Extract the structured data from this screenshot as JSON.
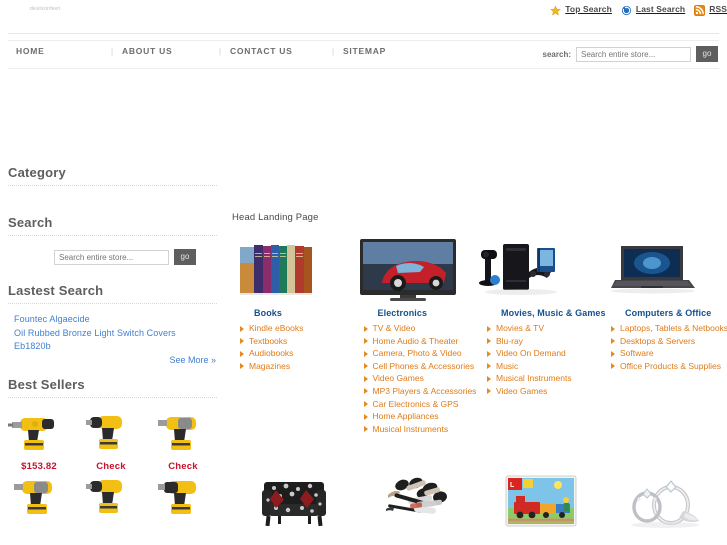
{
  "topbar": {
    "logo_text": "dealsonfeet",
    "links": [
      {
        "label": "Top Search",
        "icon": "star-icon"
      },
      {
        "label": "Last Search",
        "icon": "refresh-clock-icon"
      },
      {
        "label": "RSS",
        "icon": "rss-icon"
      }
    ]
  },
  "nav": {
    "items": [
      "HOME",
      "ABOUT US",
      "CONTACT US",
      "SITEMAP"
    ],
    "separator": "|",
    "search_label": "search:",
    "search_placeholder": "Search entire store...",
    "search_value": "",
    "go_label": "go"
  },
  "sidebar": {
    "category_heading": "Category",
    "search_heading": "Search",
    "search_placeholder": "Search entire store...",
    "search_value": "",
    "go_label": "go",
    "latest_search_heading": "Lastest Search",
    "latest_searches": [
      "Fountec Algaecide",
      "Oil Rubbed Bronze Light Switch Covers",
      "Eb1820b"
    ],
    "see_more_label": "See More »",
    "best_sellers_heading": "Best Sellers",
    "best_sellers": [
      {
        "image": "cordless-drill-image",
        "price": "$153.82"
      },
      {
        "image": "cordless-drill-image",
        "price": "Check"
      },
      {
        "image": "cordless-drill-image",
        "price": "Check"
      },
      {
        "image": "cordless-drill-image",
        "price": ""
      },
      {
        "image": "cordless-drill-image",
        "price": ""
      },
      {
        "image": "cordless-drill-image",
        "price": ""
      }
    ]
  },
  "main": {
    "title": "Head Landing Page",
    "categories": [
      {
        "title": "Books",
        "image": "book-set-image",
        "links": [
          "Kindle eBooks",
          "Textbooks",
          "Audiobooks",
          "Magazines"
        ]
      },
      {
        "title": "Electronics",
        "image": "flatscreen-tv-image",
        "links": [
          "TV & Video",
          "Home Audio & Theater",
          "Camera, Photo & Video",
          "Cell Phones & Accessories",
          "Video Games",
          "MP3 Players & Accessories",
          "Car Electronics & GPS",
          "Home Appliances",
          "Musical Instruments"
        ]
      },
      {
        "title": "Movies, Music & Games",
        "image": "game-console-image",
        "links": [
          "Movies & TV",
          "Blu-ray",
          "Video On Demand",
          "Music",
          "Musical Instruments",
          "Video Games"
        ]
      },
      {
        "title": "Computers & Office",
        "image": "laptop-image",
        "links": [
          "Laptops, Tablets & Netbooks",
          "Desktops & Servers",
          "Software",
          "Office Products & Supplies"
        ]
      }
    ]
  },
  "bottom_products": [
    {
      "image": "armchair-image"
    },
    {
      "image": "makeup-brush-set-image"
    },
    {
      "image": "lego-train-set-image"
    },
    {
      "image": "diamond-rings-image"
    }
  ],
  "colors": {
    "link_orange": "#e07b17",
    "heading_blue": "#16508f",
    "latest_link_blue": "#3f7fd0",
    "price_red": "#c8102e",
    "heading_gray": "#5e5e5e"
  }
}
